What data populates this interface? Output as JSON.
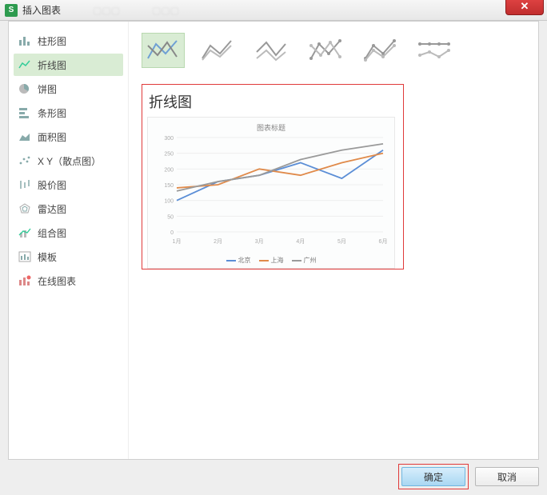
{
  "window": {
    "title": "插入图表",
    "close_glyph": "✕"
  },
  "sidebar": {
    "items": [
      {
        "id": "column",
        "label": "柱形图"
      },
      {
        "id": "line",
        "label": "折线图",
        "selected": true
      },
      {
        "id": "pie",
        "label": "饼图"
      },
      {
        "id": "bar",
        "label": "条形图"
      },
      {
        "id": "area",
        "label": "面积图"
      },
      {
        "id": "scatter",
        "label": "X Y（散点图）"
      },
      {
        "id": "stock",
        "label": "股价图"
      },
      {
        "id": "radar",
        "label": "雷达图"
      },
      {
        "id": "combo",
        "label": "组合图"
      },
      {
        "id": "template",
        "label": "模板"
      },
      {
        "id": "online",
        "label": "在线图表"
      }
    ]
  },
  "subtypes": [
    {
      "id": "line-basic",
      "selected": true
    },
    {
      "id": "line-stacked"
    },
    {
      "id": "line-percent"
    },
    {
      "id": "line-markers"
    },
    {
      "id": "line-markers-stacked"
    },
    {
      "id": "line-markers-percent"
    }
  ],
  "preview": {
    "heading": "折线图"
  },
  "footer": {
    "ok": "确定",
    "cancel": "取消"
  },
  "chart_data": {
    "type": "line",
    "title": "图表标题",
    "xlabel": "",
    "ylabel": "",
    "categories": [
      "1月",
      "2月",
      "3月",
      "4月",
      "5月",
      "6月"
    ],
    "ylim": [
      0,
      300
    ],
    "yticks": [
      0,
      50,
      100,
      150,
      200,
      250,
      300
    ],
    "series": [
      {
        "name": "北京",
        "color": "#5b8ed6",
        "values": [
          100,
          160,
          180,
          220,
          170,
          260
        ]
      },
      {
        "name": "上海",
        "color": "#e08a4a",
        "values": [
          140,
          150,
          200,
          180,
          220,
          250
        ]
      },
      {
        "name": "广州",
        "color": "#9a9a9a",
        "values": [
          130,
          160,
          180,
          230,
          260,
          280
        ]
      }
    ],
    "legend_position": "bottom",
    "grid": true
  }
}
